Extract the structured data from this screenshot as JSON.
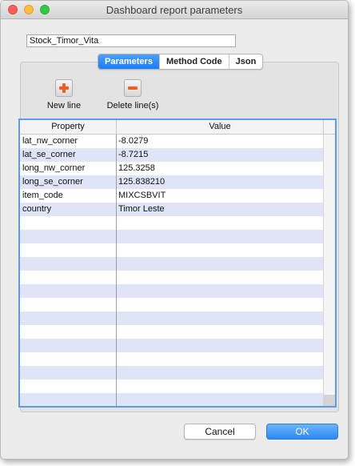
{
  "window": {
    "title": "Dashboard report parameters"
  },
  "report_name": {
    "value": "Stock_Timor_Vita"
  },
  "tabs": [
    {
      "label": "Parameters",
      "active": true
    },
    {
      "label": "Method Code",
      "active": false
    },
    {
      "label": "Json",
      "active": false
    }
  ],
  "toolbar": {
    "new_line_label": "New line",
    "new_line_icon": "plus-icon",
    "delete_line_label": "Delete line(s)",
    "delete_line_icon": "minus-icon"
  },
  "table": {
    "columns": [
      "Property",
      "Value"
    ],
    "rows": [
      {
        "property": "lat_nw_corner",
        "value": "-8.0279"
      },
      {
        "property": "lat_se_corner",
        "value": "-8.7215"
      },
      {
        "property": "long_nw_corner",
        "value": "125.3258"
      },
      {
        "property": "long_se_corner",
        "value": "125.838210"
      },
      {
        "property": "item_code",
        "value": "MIXCSBVIT"
      },
      {
        "property": "country",
        "value": "Timor Leste"
      }
    ],
    "empty_rows": 14
  },
  "buttons": {
    "cancel": "Cancel",
    "ok": "OK"
  },
  "colors": {
    "accent": "#1c7ef4",
    "selection_border": "#5b9be8",
    "alt_row": "#dfe4f7",
    "icon_orange": "#e8602a"
  }
}
